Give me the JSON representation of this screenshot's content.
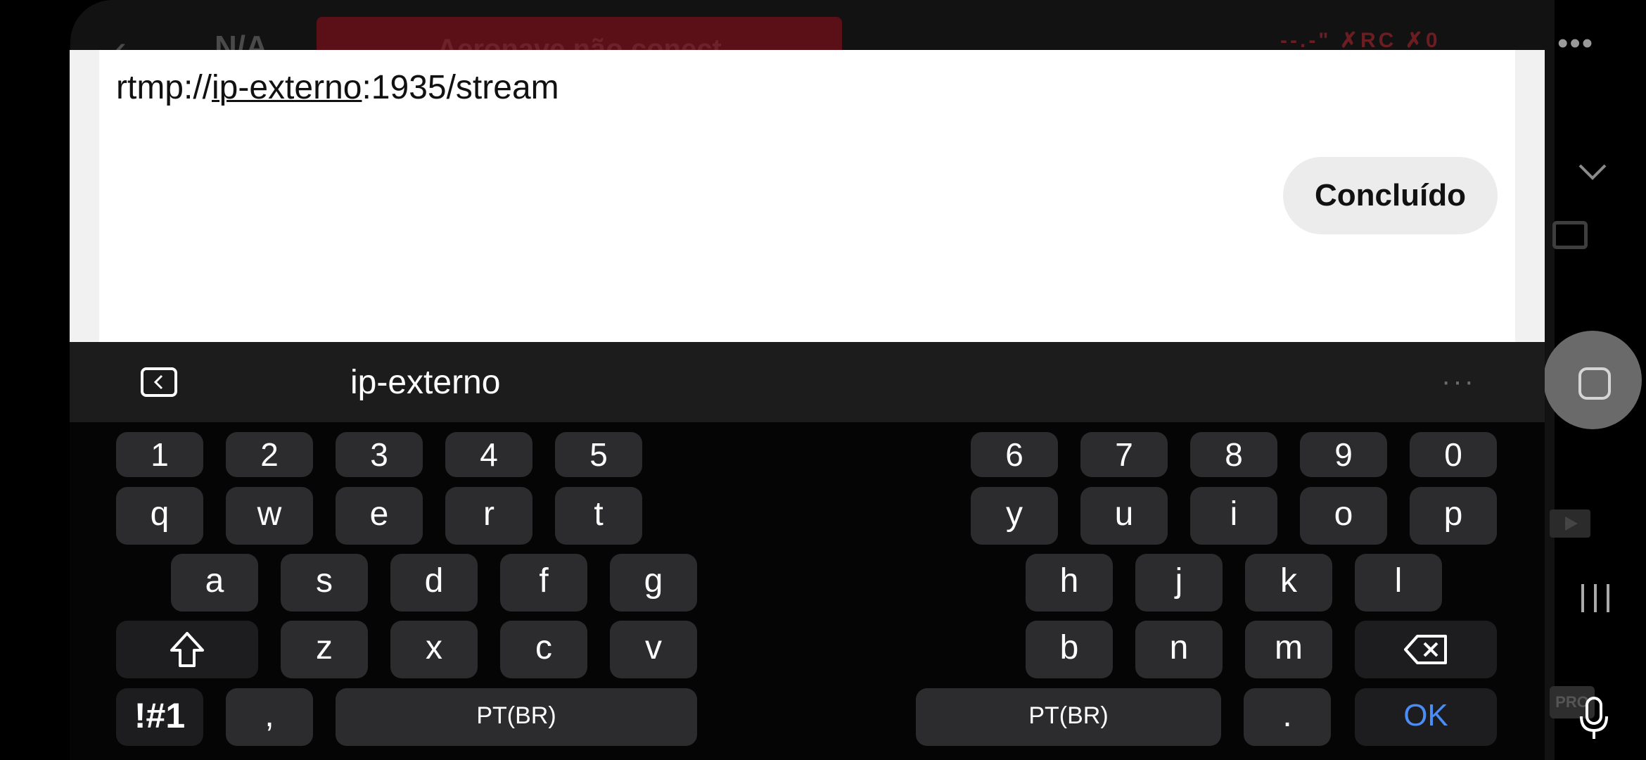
{
  "background_app": {
    "na_label": "N/A",
    "alert": "Aeronave não conect",
    "signal_text": "RC",
    "colors": {
      "alert_bg": "#5a1016"
    }
  },
  "editor": {
    "url_prefix": "rtmp://",
    "url_highlight": "ip-externo",
    "url_suffix": ":1935/stream",
    "done_label": "Concluído"
  },
  "suggestion_bar": {
    "word": "ip-externo",
    "more": "···"
  },
  "keyboard": {
    "left_numbers": [
      "1",
      "2",
      "3",
      "4",
      "5"
    ],
    "right_numbers": [
      "6",
      "7",
      "8",
      "9",
      "0"
    ],
    "left_row1": [
      "q",
      "w",
      "e",
      "r",
      "t"
    ],
    "right_row1": [
      "y",
      "u",
      "i",
      "o",
      "p"
    ],
    "left_row2": [
      "a",
      "s",
      "d",
      "f",
      "g"
    ],
    "right_row2": [
      "h",
      "j",
      "k",
      "l"
    ],
    "left_row3": [
      "z",
      "x",
      "c",
      "v"
    ],
    "right_row3": [
      "b",
      "n",
      "m"
    ],
    "symbols_label": "!#1",
    "comma": ",",
    "space_left": "PT(BR)",
    "space_right": "PT(BR)",
    "period": ".",
    "ok_label": "OK",
    "colors": {
      "key": "#2c2c2e",
      "ok_text": "#4b8cf5"
    }
  }
}
